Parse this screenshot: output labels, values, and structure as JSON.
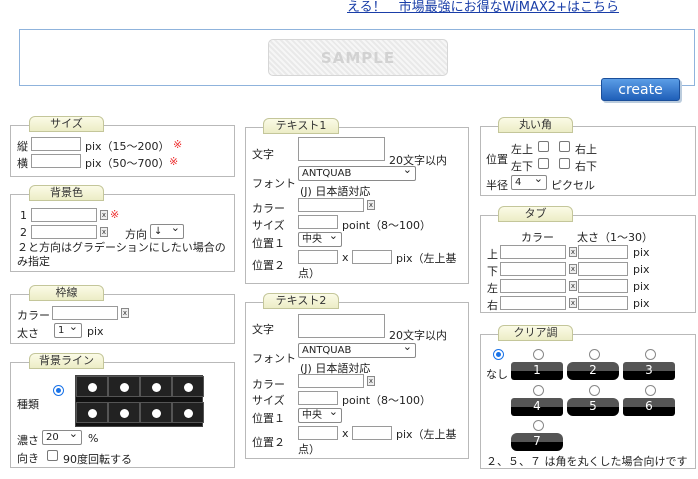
{
  "header": {
    "promo_link": "える！　市場最強にお得なWiMAX2+はこちら"
  },
  "preview": {
    "sample_label": "SAMPLE",
    "create_button": "create"
  },
  "size": {
    "title": "サイズ",
    "height_label": "縦",
    "height_unit": "pix（15〜200）",
    "width_label": "横",
    "width_unit": "pix（50〜700）",
    "required": "※"
  },
  "bg_color": {
    "title": "背景色",
    "row1": "1",
    "row2": "2",
    "direction_label": "方向",
    "direction_value": "↓",
    "note": "２と方向はグラデーションにしたい場合のみ指定",
    "required": "※"
  },
  "border": {
    "title": "枠線",
    "color_label": "カラー",
    "width_label": "太さ",
    "width_value": "1",
    "unit": "pix"
  },
  "bg_line": {
    "title": "背景ライン",
    "type_label": "種類",
    "density_label": "濃さ",
    "density_value": "20",
    "percent": "%",
    "direction_label": "向き",
    "rotate_label": "90度回転する"
  },
  "text1": {
    "title": "テキスト1",
    "text_label": "文字",
    "limit": "20文字以内",
    "font_label": "フォント",
    "font_value": "ANTQUAB",
    "font_note": "(J) 日本語対応",
    "color_label": "カラー",
    "size_label": "サイズ",
    "size_unit": "point（8〜100）",
    "pos1_label": "位置１",
    "pos1_value": "中央",
    "pos2_label": "位置２",
    "pos2_sep": "x",
    "pos2_unit": "pix（左上基点）"
  },
  "text2": {
    "title": "テキスト2",
    "text_label": "文字",
    "limit": "20文字以内",
    "font_label": "フォント",
    "font_value": "ANTQUAB",
    "font_note": "(J) 日本語対応",
    "color_label": "カラー",
    "size_label": "サイズ",
    "size_unit": "point（8〜100）",
    "pos1_label": "位置１",
    "pos1_value": "中央",
    "pos2_label": "位置２",
    "pos2_sep": "x",
    "pos2_unit": "pix（左上基点）"
  },
  "corner": {
    "title": "丸い角",
    "pos_label": "位置",
    "top_left": "左上",
    "top_right": "右上",
    "bottom_left": "左下",
    "bottom_right": "右下",
    "radius_label": "半径",
    "radius_value": "4",
    "unit": "ピクセル"
  },
  "tab": {
    "title": "タブ",
    "color_head": "カラー",
    "width_head": "太さ（1〜30）",
    "top": "上",
    "bottom": "下",
    "left": "左",
    "right": "右",
    "unit": "pix"
  },
  "clear": {
    "title": "クリア調",
    "none_label": "なし",
    "options": [
      "1",
      "2",
      "3",
      "4",
      "5",
      "6",
      "7"
    ],
    "note": "２、５、７ は角を丸くした場合向けです"
  }
}
